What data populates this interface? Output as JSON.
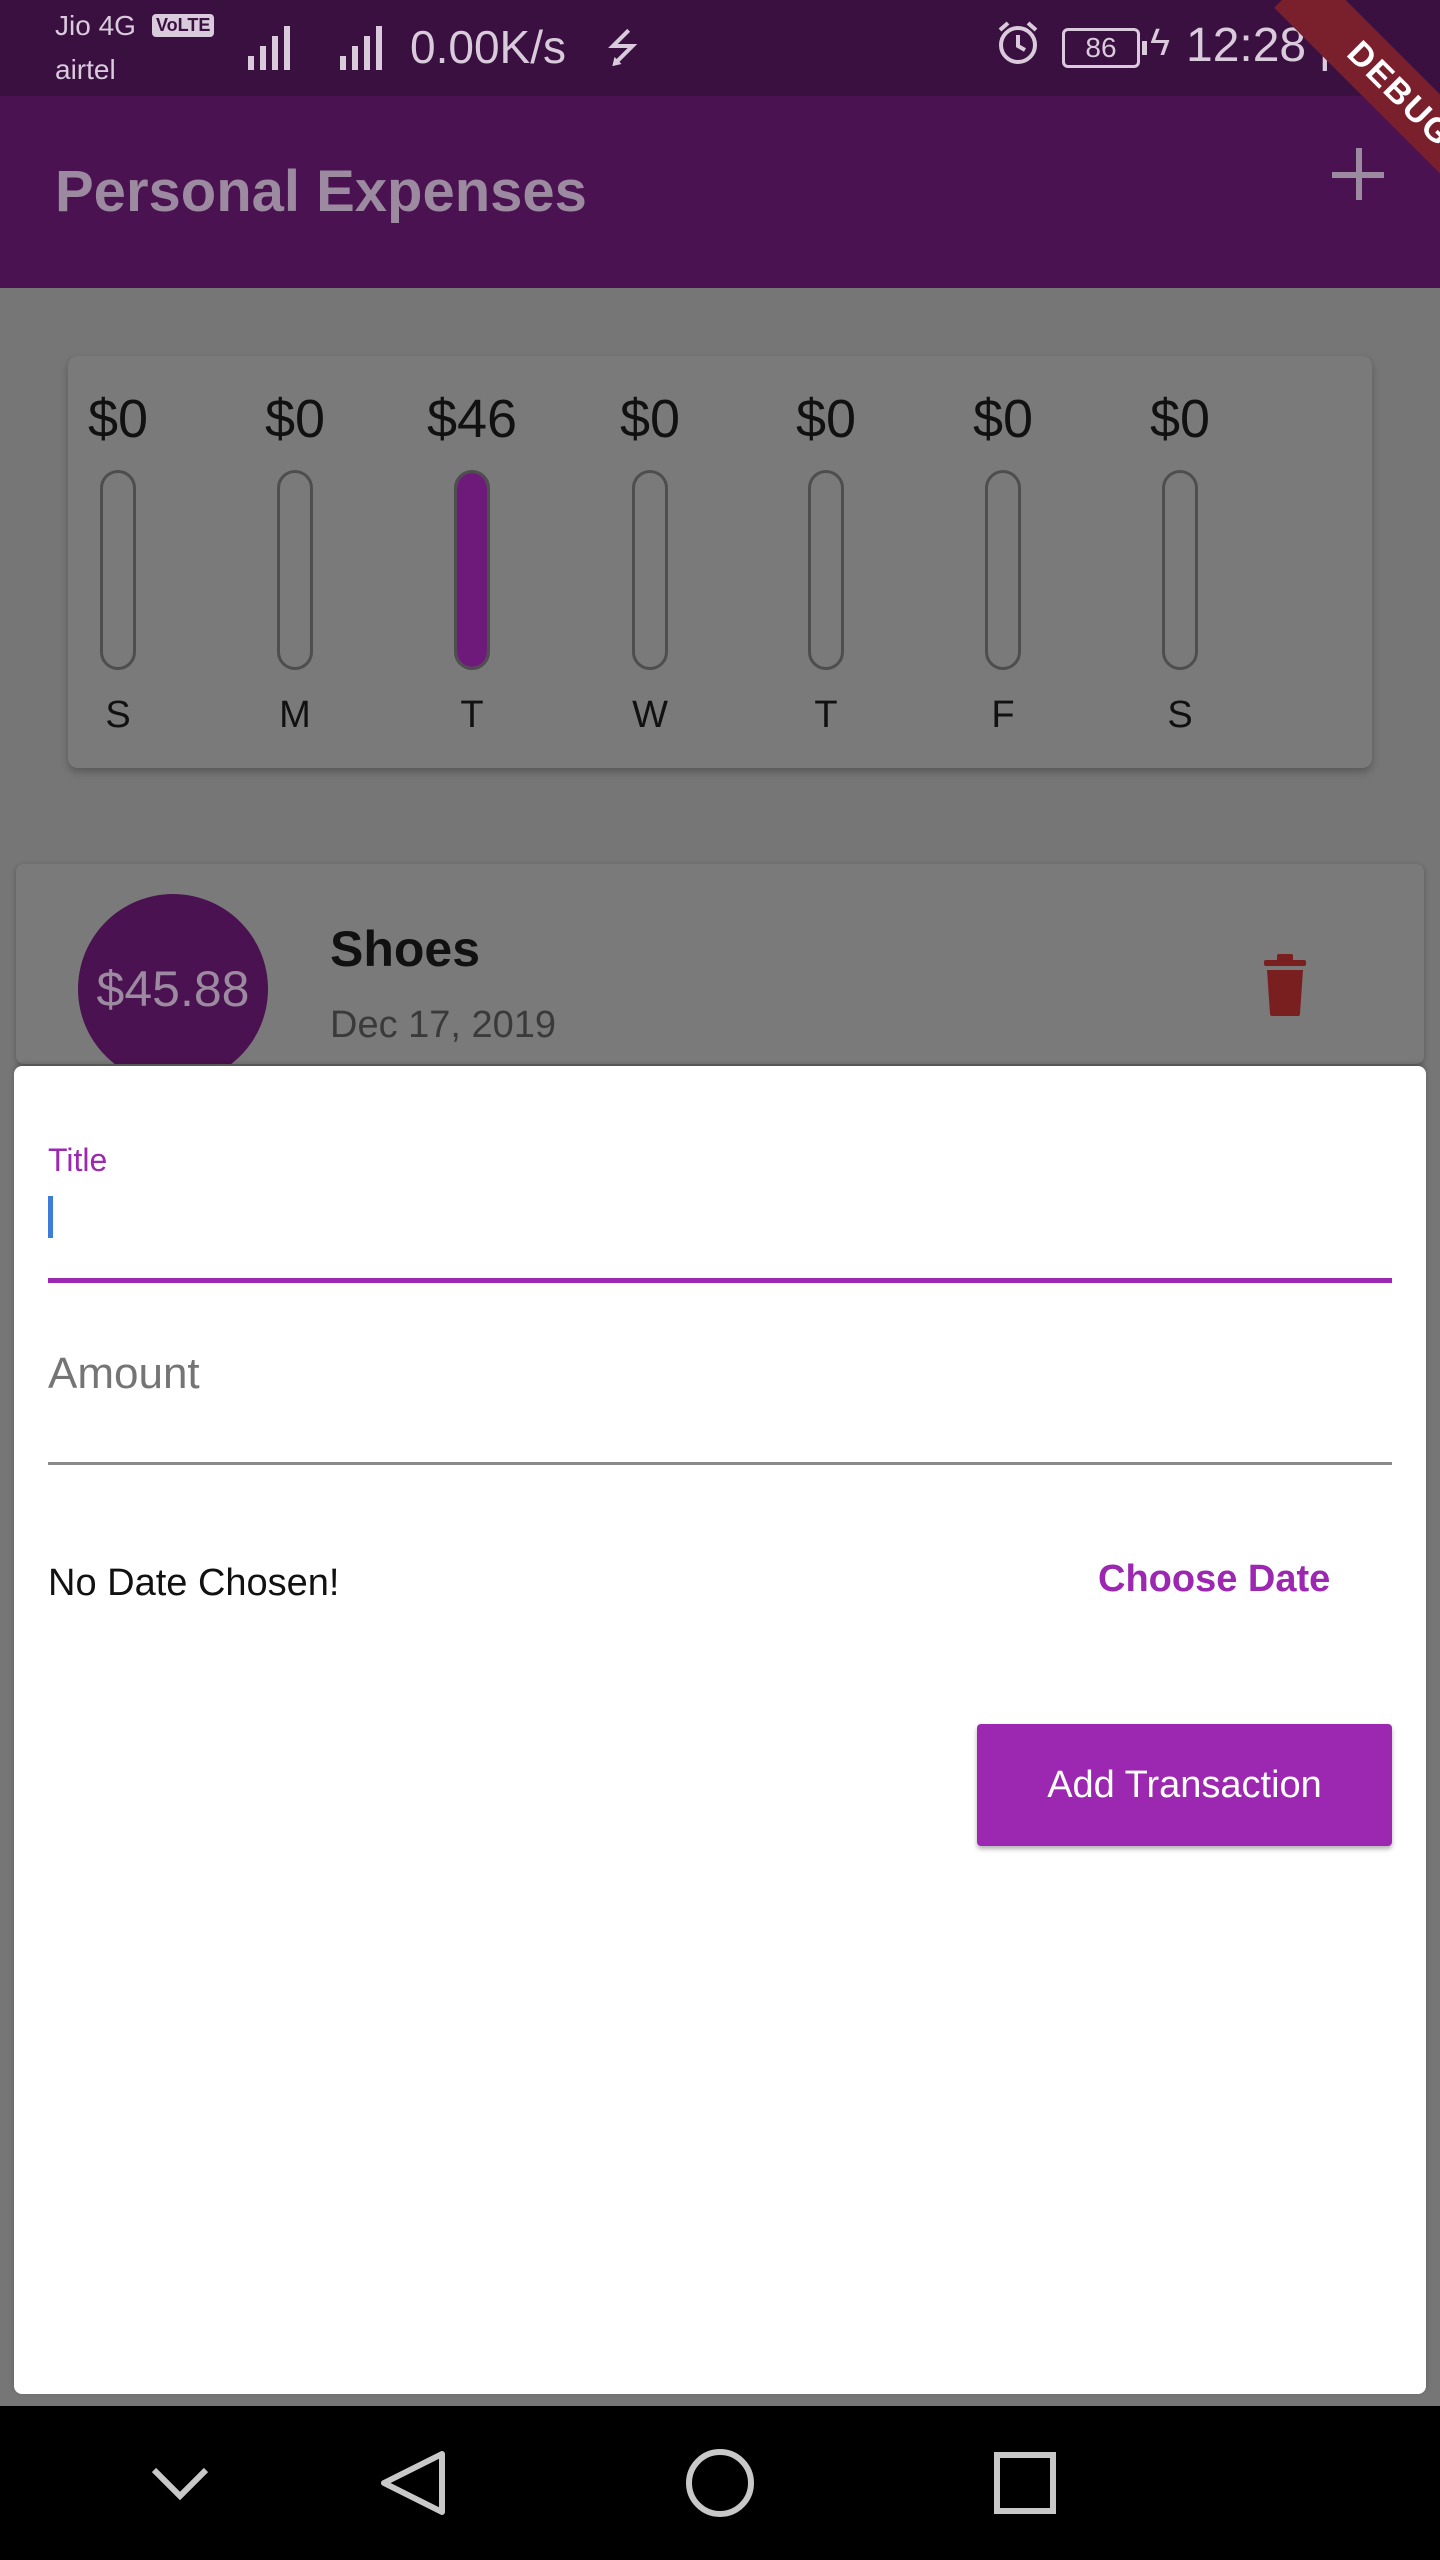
{
  "status_bar": {
    "carrier_1": "Jio 4G",
    "volte_badge": "VoLTE",
    "carrier_2": "airtel",
    "network_speed": "0.00K/s",
    "battery_level": "86",
    "time": "12:28 pm"
  },
  "debug_banner": "DEBUG",
  "app_bar": {
    "title": "Personal Expenses",
    "add_icon": "plus-icon"
  },
  "chart_data": {
    "type": "bar",
    "categories": [
      "S",
      "M",
      "T",
      "W",
      "T",
      "F",
      "S"
    ],
    "value_labels": [
      "$0",
      "$0",
      "$46",
      "$0",
      "$0",
      "$0",
      "$0"
    ],
    "values": [
      0,
      0,
      45.88,
      0,
      0,
      0,
      0
    ],
    "fill_fraction": [
      0,
      0,
      1,
      0,
      0,
      0,
      0
    ],
    "colors": {
      "fill": "#6d1a7a",
      "track": "#7a7a7a"
    }
  },
  "transactions": [
    {
      "amount": "$45.88",
      "title": "Shoes",
      "date": "Dec 17, 2019",
      "delete_icon": "trash-icon"
    }
  ],
  "new_transaction": {
    "title_label": "Title",
    "title_value": "",
    "amount_placeholder": "Amount",
    "date_status": "No Date Chosen!",
    "choose_date_label": "Choose Date",
    "submit_label": "Add Transaction"
  },
  "colors": {
    "primary": "#9c27b0",
    "app_bar": "#4a1250",
    "delete": "#7a1f1f"
  },
  "nav_bar": {
    "icons": [
      "chevron-down-icon",
      "back-icon",
      "home-icon",
      "recents-icon"
    ]
  }
}
